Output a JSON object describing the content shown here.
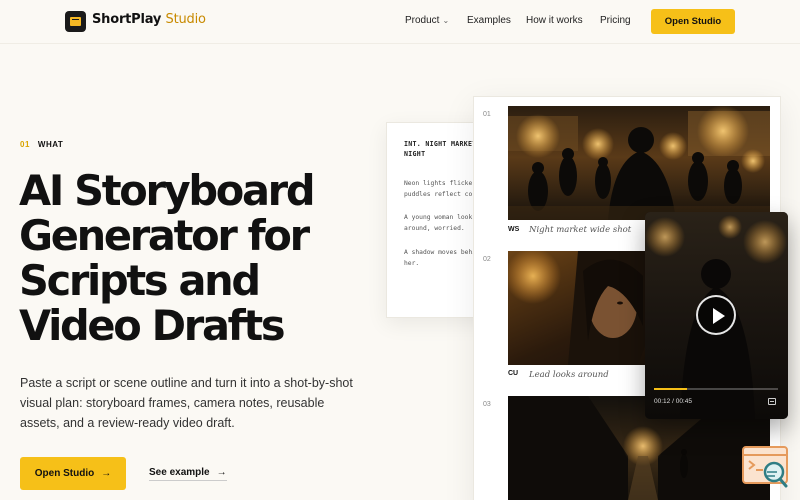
{
  "nav": {
    "brand_main": "ShortPlay",
    "brand_accent": "Studio",
    "links": [
      {
        "label": "Product",
        "has_dropdown": true
      },
      {
        "label": "Examples"
      },
      {
        "label": "How it works"
      },
      {
        "label": "Pricing"
      }
    ],
    "cta_label": "Open Studio"
  },
  "hero": {
    "eyebrow_number": "01",
    "eyebrow_label": "WHAT",
    "headline_lines": [
      "AI Storyboard",
      "Generator for",
      "Scripts and",
      "Video Drafts"
    ],
    "description": "Paste a script or scene outline and turn it into a shot-by-shot visual plan: storyboard frames, camera notes, reusable assets, and a review-ready video draft.",
    "primary_cta": "Open Studio",
    "secondary_cta": "See example"
  },
  "script_card": {
    "heading": "INT. NIGHT MARKET - NIGHT",
    "lines": [
      "Neon lights flicker,",
      "puddles reflect co",
      "A young woman look",
      "around, worried.",
      "A shadow moves behi",
      "her."
    ]
  },
  "storyboard": {
    "shots": [
      {
        "number": "01",
        "type": "WS",
        "caption": "Night market wide shot"
      },
      {
        "number": "02",
        "type": "CU",
        "caption": "Lead looks around"
      },
      {
        "number": "03",
        "type": "",
        "caption": ""
      }
    ]
  },
  "video": {
    "current_time": "00:12",
    "duration": "00:45",
    "progress": 0.27
  },
  "colors": {
    "accent": "#f6c018",
    "background": "#fbf9f4",
    "text": "#111111"
  },
  "icons": {
    "logo": "clapperboard-icon",
    "play": "play-icon",
    "arrow": "arrow-right-icon",
    "dropdown": "chevron-down-icon",
    "widget": "code-search-icon",
    "subtitles": "captions-icon"
  }
}
